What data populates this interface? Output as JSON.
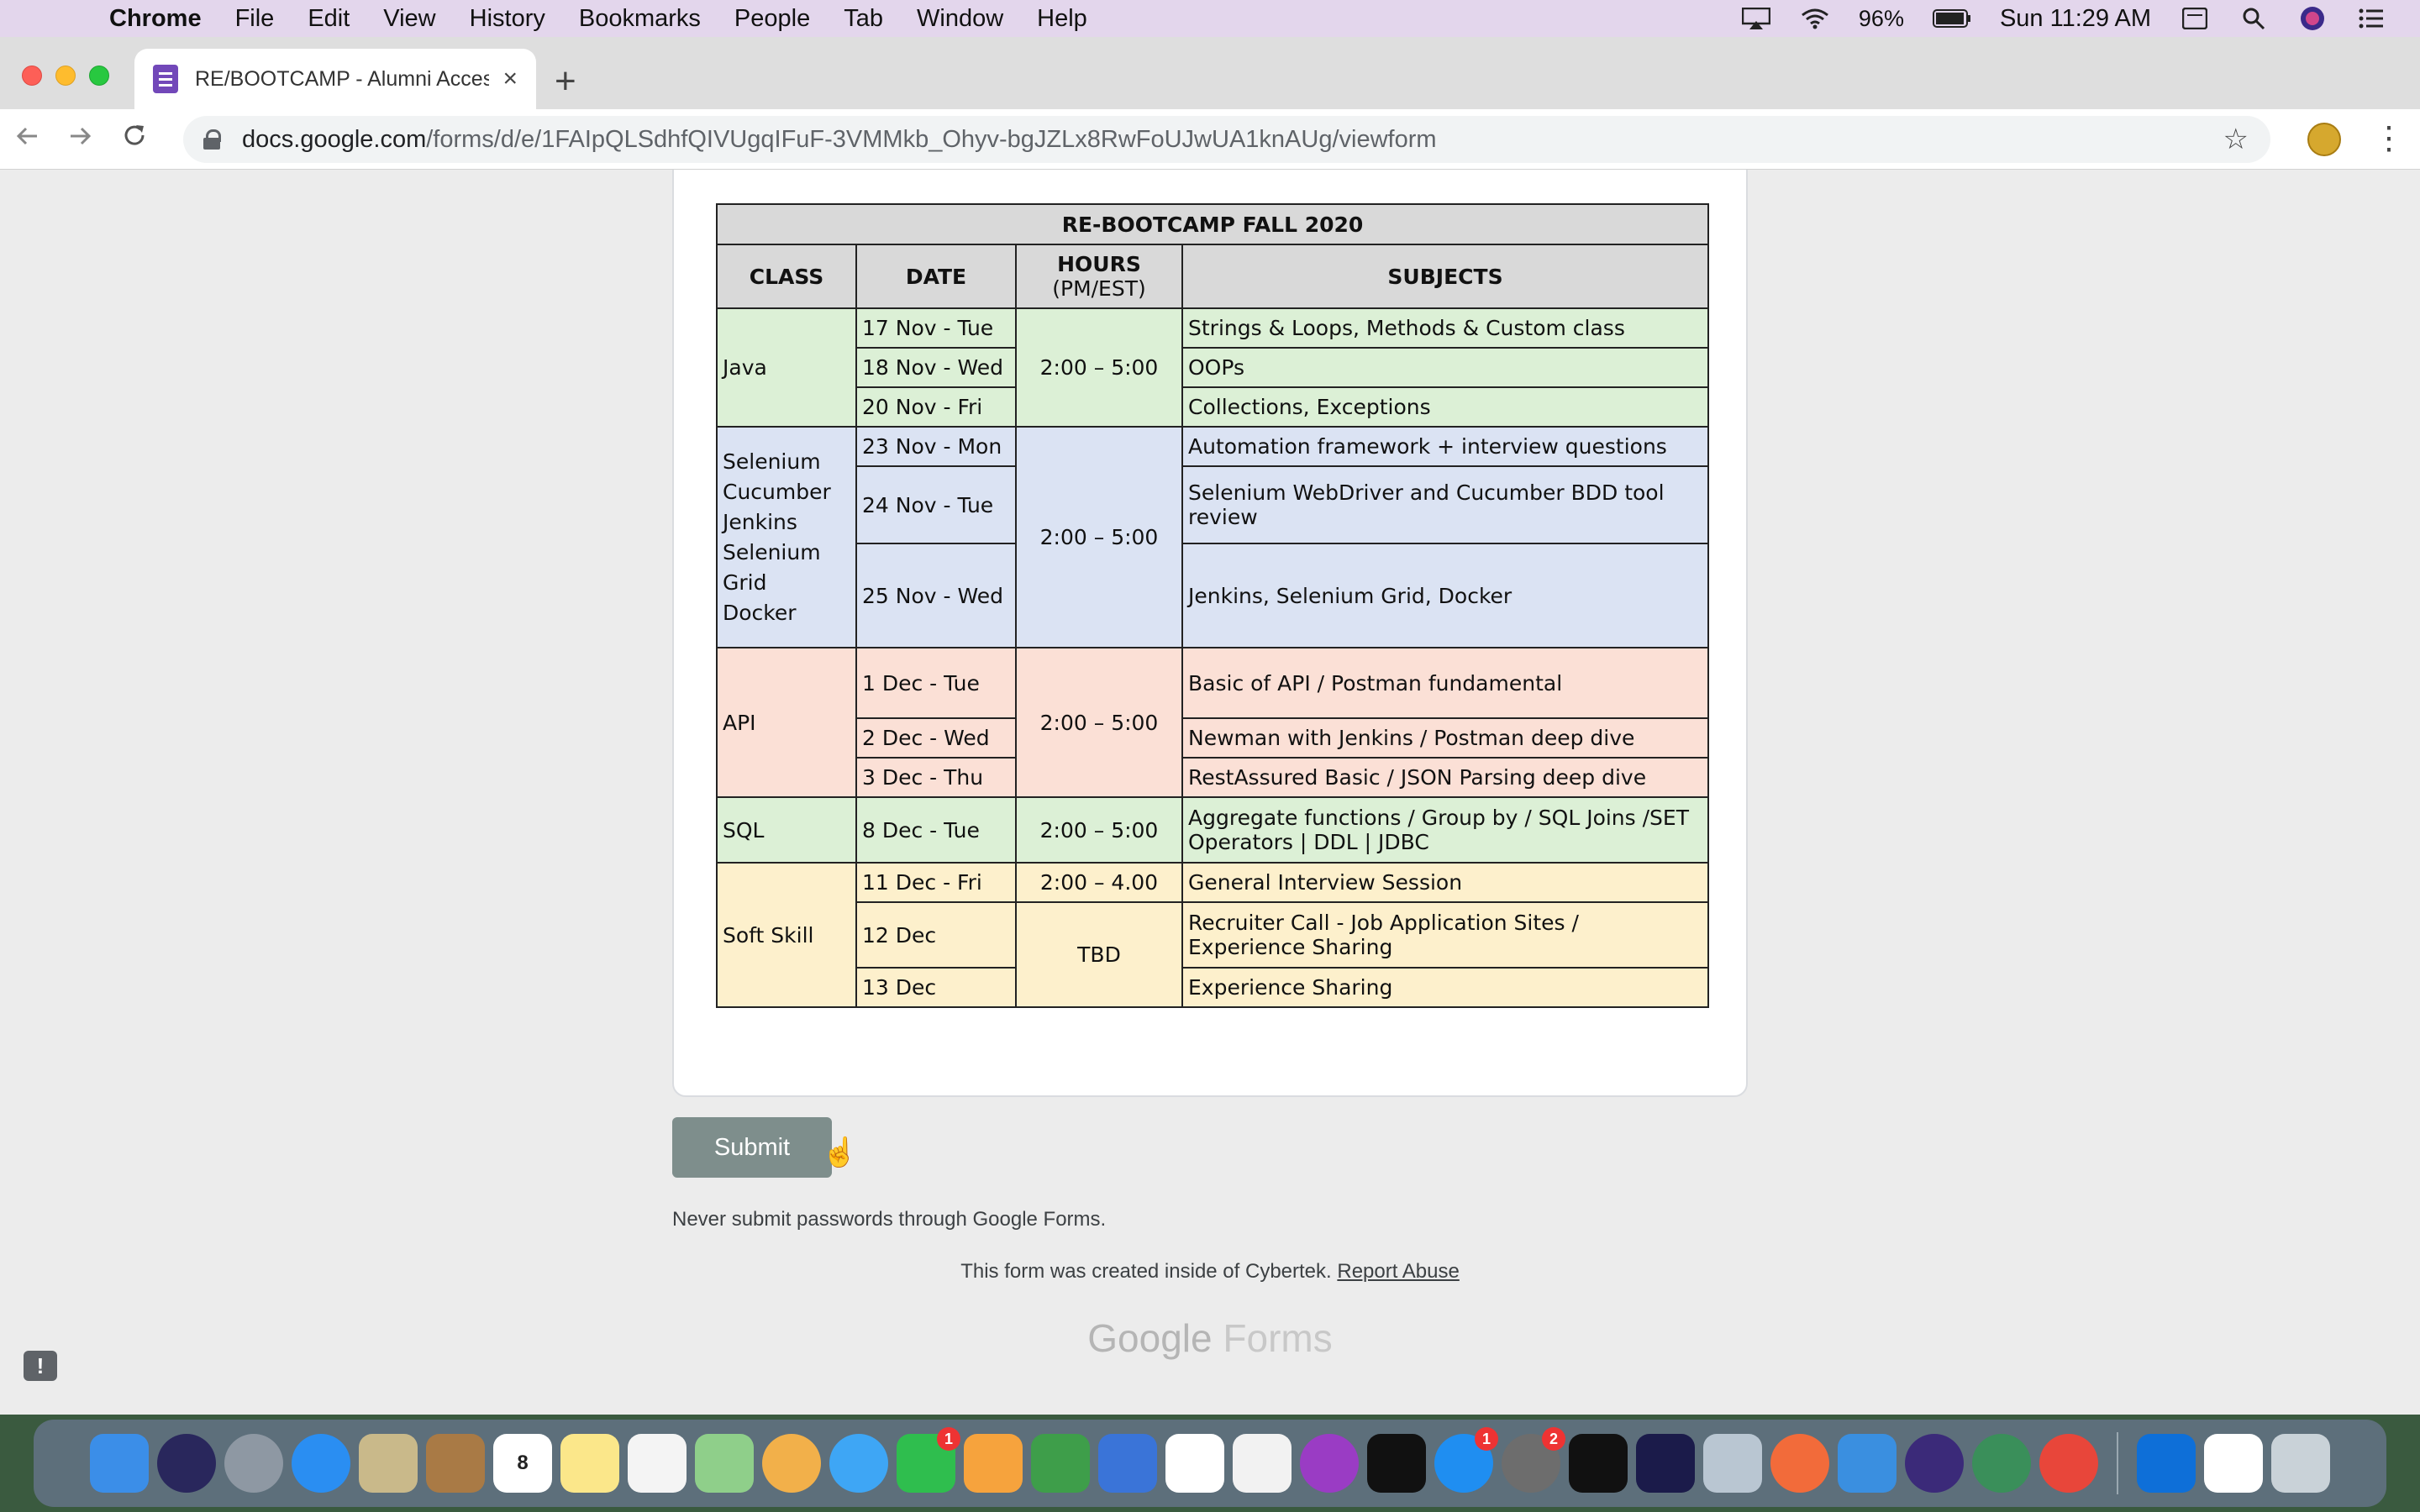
{
  "menubar": {
    "app": "Chrome",
    "items": [
      "File",
      "Edit",
      "View",
      "History",
      "Bookmarks",
      "People",
      "Tab",
      "Window",
      "Help"
    ],
    "battery": "96%",
    "clock": "Sun 11:29 AM"
  },
  "tab": {
    "title": "RE/BOOTCAMP - Alumni Acces",
    "close": "×",
    "new": "+"
  },
  "address": {
    "domain": "docs.google.com",
    "path": "/forms/d/e/1FAIpQLSdhfQIVUgqIFuF-3VMMkb_Ohyv-bgJZLx8RwFoUJwUA1knAUg/viewform"
  },
  "schedule": {
    "title": "RE-BOOTCAMP FALL 2020",
    "headers": {
      "class": "CLASS",
      "date": "DATE",
      "hours": "HOURS",
      "hours_sub": "(PM/EST)",
      "subjects": "SUBJECTS"
    },
    "java": {
      "class": "Java",
      "hours": "2:00 – 5:00",
      "rows": [
        {
          "date": "17 Nov - Tue",
          "subject": "Strings & Loops, Methods & Custom class"
        },
        {
          "date": "18 Nov - Wed",
          "subject": "OOPs"
        },
        {
          "date": "20 Nov - Fri",
          "subject": "Collections, Exceptions"
        }
      ]
    },
    "selenium": {
      "class_lines": [
        "Selenium",
        "Cucumber",
        "Jenkins",
        "Selenium",
        "Grid",
        "Docker"
      ],
      "hours": "2:00 – 5:00",
      "rows": [
        {
          "date": "23 Nov - Mon",
          "subject": "Automation framework + interview questions"
        },
        {
          "date": "24 Nov - Tue",
          "subject": "Selenium WebDriver and Cucumber BDD tool review"
        },
        {
          "date": "25 Nov - Wed",
          "subject": "Jenkins, Selenium Grid, Docker"
        }
      ]
    },
    "api": {
      "class": "API",
      "hours": "2:00 – 5:00",
      "rows": [
        {
          "date": "1 Dec - Tue",
          "subject": "Basic of API / Postman fundamental"
        },
        {
          "date": "2 Dec - Wed",
          "subject": "Newman with Jenkins / Postman deep dive"
        },
        {
          "date": "3 Dec - Thu",
          "subject": "RestAssured Basic / JSON Parsing deep dive"
        }
      ]
    },
    "sql": {
      "class": "SQL",
      "hours": "2:00 – 5:00",
      "date": "8 Dec - Tue",
      "subject": "Aggregate functions / Group by / SQL Joins /SET Operators | DDL | JDBC"
    },
    "soft": {
      "class": "Soft Skill",
      "rows": [
        {
          "date": "11 Dec - Fri",
          "hours": "2:00 – 4.00",
          "subject": "General Interview Session"
        },
        {
          "date": "12 Dec",
          "hours": "TBD",
          "subject": "Recruiter Call - Job Application Sites / Experience Sharing"
        },
        {
          "date": "13 Dec",
          "subject": "Experience Sharing"
        }
      ]
    }
  },
  "form": {
    "submit": "Submit",
    "warning": "Never submit passwords through Google Forms.",
    "created": "This form was created inside of Cybertek.",
    "report": "Report Abuse",
    "brand_1": "Google",
    "brand_2": "Forms",
    "feedback": "!"
  },
  "dock": {
    "calendar_day": "8",
    "facetime_badge": "1",
    "appstore_badge": "1",
    "settings_badge": "2"
  }
}
